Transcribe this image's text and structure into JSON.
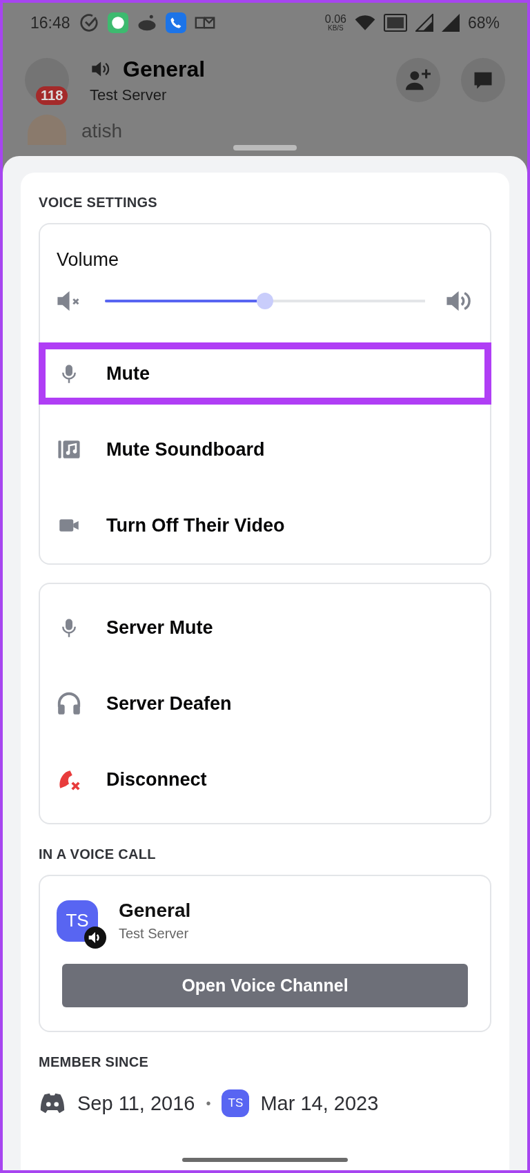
{
  "status_bar": {
    "time": "16:48",
    "net_speed": "0.06",
    "net_unit": "KB/S",
    "battery": "68%"
  },
  "header": {
    "badge": "118",
    "title": "General",
    "subtitle": "Test Server",
    "member": "atish"
  },
  "voice_settings": {
    "heading": "VOICE SETTINGS",
    "volume": {
      "label": "Volume",
      "level": 0.5
    },
    "items": [
      {
        "kind": "mic",
        "label": "Mute",
        "highlighted": true
      },
      {
        "kind": "soundboard",
        "label": "Mute Soundboard",
        "highlighted": false
      },
      {
        "kind": "video",
        "label": "Turn Off Their Video",
        "highlighted": false
      }
    ],
    "server_items": [
      {
        "kind": "mic",
        "label": "Server Mute"
      },
      {
        "kind": "headphones",
        "label": "Server Deafen"
      },
      {
        "kind": "disconnect",
        "label": "Disconnect"
      }
    ]
  },
  "voice_call": {
    "heading": "IN A VOICE CALL",
    "avatar": "TS",
    "channel": "General",
    "server": "Test Server",
    "button": "Open Voice Channel"
  },
  "member_since": {
    "heading": "MEMBER SINCE",
    "discord_date": "Sep 11, 2016",
    "separator": "•",
    "server_avatar": "TS",
    "server_date": "Mar 14, 2023"
  }
}
